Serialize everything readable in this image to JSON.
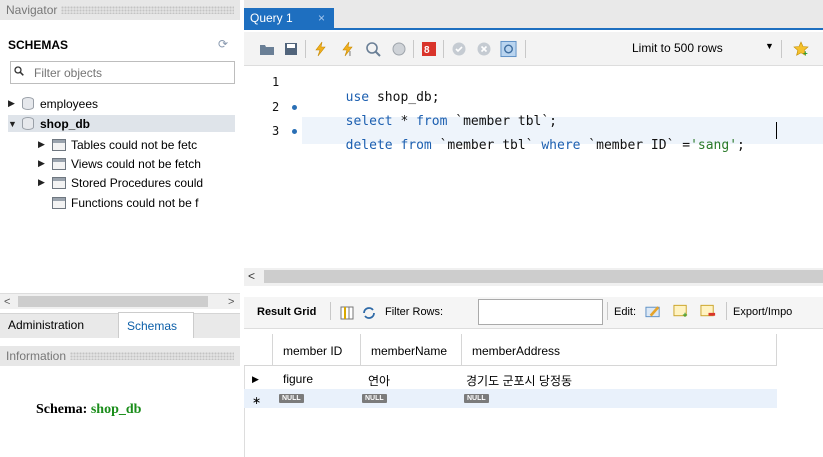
{
  "navigator": {
    "header": "Navigator",
    "schemas_title": "SCHEMAS",
    "filter_placeholder": "Filter objects",
    "tree": [
      {
        "label": "employees",
        "expanded": false
      },
      {
        "label": "shop_db",
        "expanded": true,
        "selected": true,
        "children": [
          {
            "label": "Tables could not be fetc",
            "has_arrow": true
          },
          {
            "label": "Views could not be fetch",
            "has_arrow": true
          },
          {
            "label": "Stored Procedures could",
            "has_arrow": true
          },
          {
            "label": "Functions could not be f",
            "has_arrow": false
          }
        ]
      }
    ],
    "bottom_tabs": {
      "administration": "Administration",
      "schemas": "Schemas"
    },
    "information_header": "Information",
    "schema_label": "Schema:",
    "schema_value": "shop_db"
  },
  "query_tab": {
    "label": "Query 1",
    "close": "×"
  },
  "toolbar": {
    "limit_label": "Limit to 500 rows",
    "icons": [
      "open-folder-icon",
      "save-icon",
      "execute-icon",
      "execute-current-icon",
      "explain-icon",
      "stop-icon",
      "toggle-error-icon",
      "commit-icon",
      "rollback-icon",
      "autocommit-icon",
      "limit-dropdown",
      "bookmark-icon"
    ]
  },
  "editor": {
    "lines": [
      {
        "num": "1",
        "dot": false,
        "tokens": [
          {
            "t": "use",
            "c": "kw"
          },
          {
            "t": " shop_db;",
            "c": ""
          }
        ]
      },
      {
        "num": "2",
        "dot": true,
        "tokens": [
          {
            "t": "select",
            "c": "kw"
          },
          {
            "t": " * ",
            "c": ""
          },
          {
            "t": "from",
            "c": "kw"
          },
          {
            "t": " `member tbl`;",
            "c": ""
          }
        ]
      },
      {
        "num": "3",
        "dot": true,
        "tokens": [
          {
            "t": "delete",
            "c": "kw"
          },
          {
            "t": " ",
            "c": ""
          },
          {
            "t": "from",
            "c": "kw"
          },
          {
            "t": " `member tbl` ",
            "c": ""
          },
          {
            "t": "where",
            "c": "kw"
          },
          {
            "t": " `member ID` =",
            "c": ""
          },
          {
            "t": "'sang'",
            "c": "str"
          },
          {
            "t": ";",
            "c": ""
          }
        ]
      }
    ]
  },
  "result_toolbar": {
    "result_grid": "Result Grid",
    "filter_rows": "Filter Rows:",
    "edit": "Edit:",
    "export": "Export/Impo"
  },
  "grid": {
    "columns": [
      "member ID",
      "memberName",
      "memberAddress"
    ],
    "rows": [
      [
        "figure",
        "연아",
        "경기도 군포시 당정동"
      ],
      [
        "NULL",
        "NULL",
        "NULL"
      ]
    ]
  }
}
